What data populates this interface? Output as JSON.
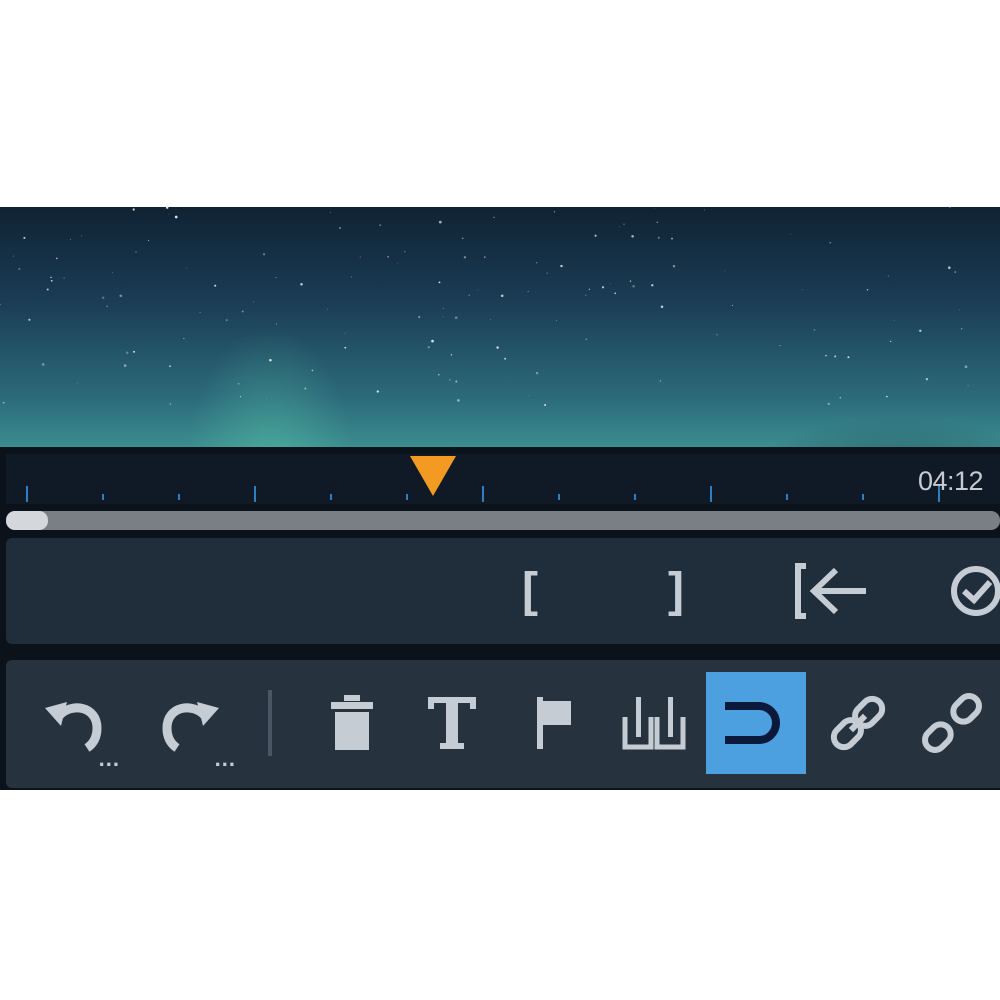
{
  "timeline": {
    "timecode": "04:12",
    "playhead_position_fraction": 0.43
  },
  "trim_controls": {
    "mark_in_label": "[",
    "mark_out_label": "]"
  },
  "toolbar": {
    "undo_more": "...",
    "redo_more": "...",
    "snap_active": true
  },
  "colors": {
    "playhead": "#f39a22",
    "active_tool": "#4da0e0",
    "panel": "#26333f",
    "icon": "#c6ccd3"
  },
  "icons": [
    "undo-icon",
    "redo-icon",
    "trash-icon",
    "text-icon",
    "flag-icon",
    "split-icon",
    "magnet-icon",
    "link-icon",
    "unlink-icon",
    "go-to-in-icon",
    "clock-icon"
  ]
}
